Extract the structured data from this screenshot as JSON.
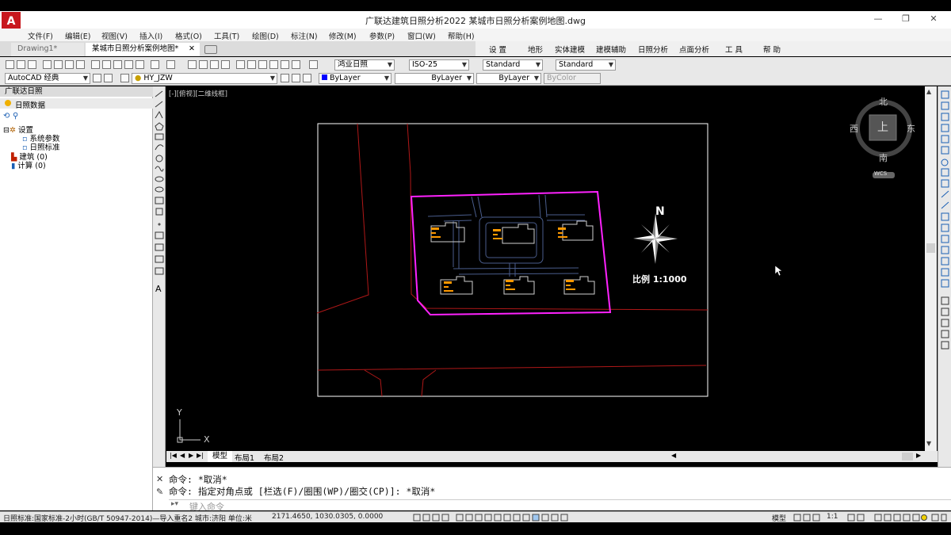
{
  "window": {
    "title": "广联达建筑日照分析2022   某城市日照分析案例地图.dwg",
    "minimize": "—",
    "restore": "❐",
    "close": "✕",
    "logo": "A"
  },
  "menu": {
    "items": [
      "文件(F)",
      "编辑(E)",
      "视图(V)",
      "插入(I)",
      "格式(O)",
      "工具(T)",
      "绘图(D)",
      "标注(N)",
      "修改(M)",
      "参数(P)",
      "窗口(W)",
      "帮助(H)"
    ]
  },
  "doc_tabs": {
    "tab1": "Drawing1*",
    "tab2": "某城市日照分析案例地图*",
    "close": "✕"
  },
  "ribbon": {
    "items": [
      "设  置",
      "地形",
      "实体建模",
      "建模辅助",
      "日照分析",
      "点面分析",
      "工  具",
      "帮  助"
    ]
  },
  "toolbar": {
    "style_combo": "鸿业日照",
    "dim_combo": "ISO-25",
    "text_style": "Standard",
    "table_style": "Standard",
    "workspace": "AutoCAD 经典",
    "layer": "HY_JZW",
    "color": "ByLayer",
    "linetype": "ByLayer",
    "lineweight": "ByLayer",
    "plotstyle": "ByColor"
  },
  "left_panel": {
    "title": "广联达日照",
    "tab": "日照数据",
    "tree": [
      {
        "label": "设置"
      },
      {
        "label": "系统参数"
      },
      {
        "label": "日照标准"
      },
      {
        "label": "建筑  (0)"
      },
      {
        "label": "计算  (0)"
      }
    ]
  },
  "canvas": {
    "viewport_label": "[-][俯视][二维线框]",
    "compass": {
      "n": "北",
      "s": "南",
      "e": "东",
      "w": "西",
      "center": "上",
      "wcs": "WCS"
    },
    "north_label": "N",
    "scale_label": "比例 1:1000",
    "ucs_x": "X",
    "ucs_y": "Y",
    "colors": {
      "boundary": "#ff22ff",
      "roads": "#b01818",
      "paths": "#4a5d8c",
      "buildings": "#d0d0d0",
      "frame": "#ffffff",
      "labels": "#ff9900"
    }
  },
  "layout_tabs": {
    "model": "模型",
    "layout1": "布局1",
    "layout2": "布局2"
  },
  "command": {
    "line1": "命令: *取消*",
    "line2": "命令: 指定对角点或 [栏选(F)/圈围(WP)/圈交(CP)]: *取消*",
    "placeholder": "键入命令"
  },
  "status": {
    "left": "日照标准:国家标准-2小时(GB/T 50947-2014)—导入重名2  城市:济阳  单位:米",
    "coords": "2171.4650, 1030.0305, 0.0000",
    "model": "模型",
    "scale": "1:1"
  }
}
